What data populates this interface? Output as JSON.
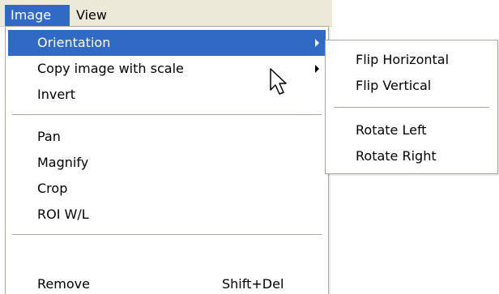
{
  "menubar": {
    "items": [
      {
        "label": "Image",
        "active": true
      },
      {
        "label": "View",
        "active": false
      }
    ]
  },
  "image_menu": {
    "items": [
      {
        "label": "Orientation",
        "has_submenu": true,
        "highlighted": true
      },
      {
        "label": "Copy image with scale",
        "has_submenu": true
      },
      {
        "label": "Invert"
      },
      {
        "label": "Pan"
      },
      {
        "label": "Magnify"
      },
      {
        "label": "Crop"
      },
      {
        "label": "ROI W/L"
      },
      {
        "label": "Remove",
        "shortcut": "Shift+Del"
      }
    ]
  },
  "orientation_submenu": {
    "items": [
      {
        "label": "Flip Horizontal"
      },
      {
        "label": "Flip Vertical"
      },
      {
        "label": "Rotate Left"
      },
      {
        "label": "Rotate Right"
      }
    ]
  },
  "colors": {
    "highlight": "#316ac5",
    "menubar_bg": "#ece9d8",
    "border": "#aca899"
  },
  "icons": {
    "cursor": "arrow-cursor-icon",
    "submenu_arrow": "submenu-arrow-icon"
  }
}
